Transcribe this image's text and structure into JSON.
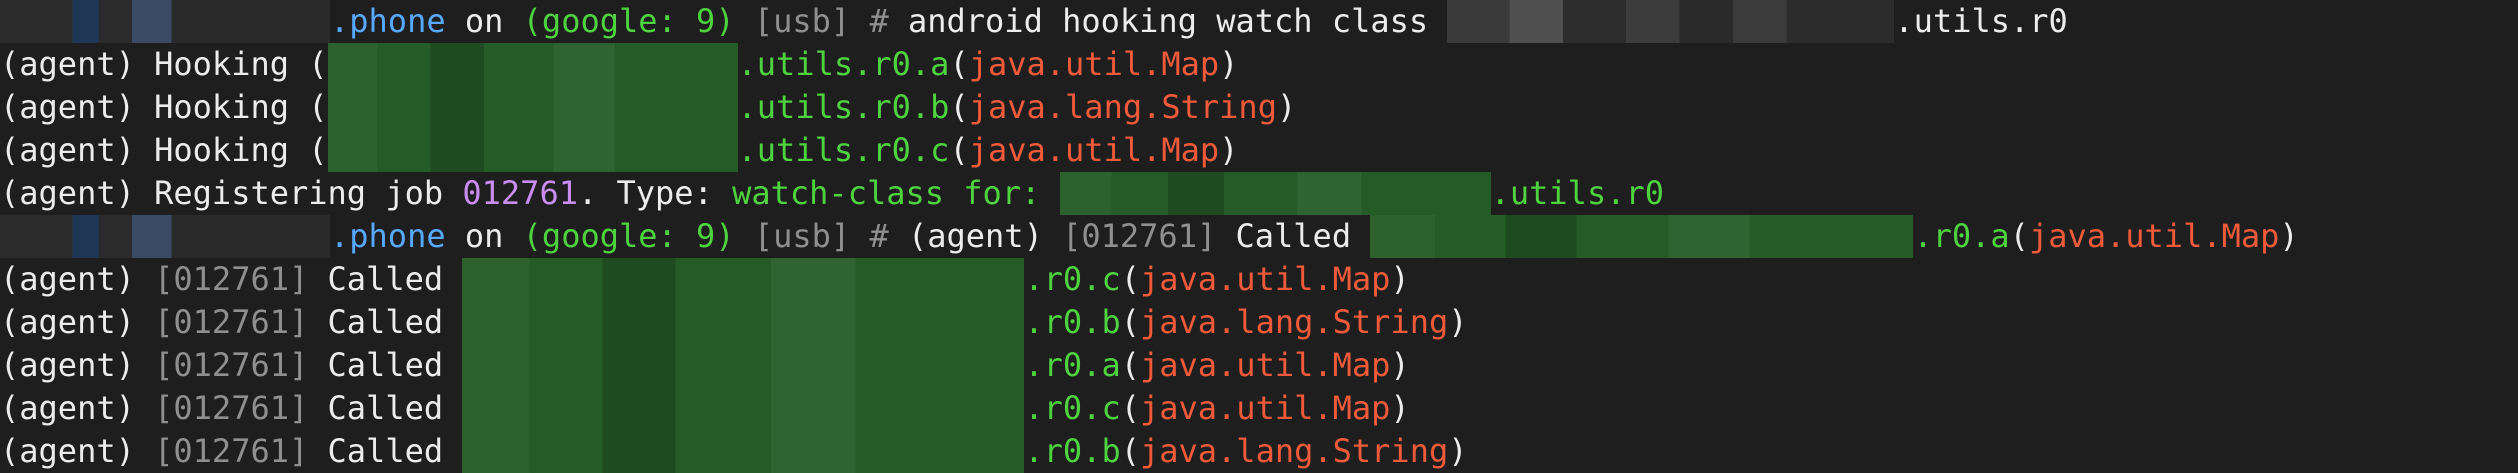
{
  "prompt": {
    "host_suffix": ".phone",
    "on_word": " on ",
    "device": "(google: 9)",
    "transport": " [usb]",
    "hash": " # "
  },
  "lines": [
    {
      "kind": "command",
      "command": "android hooking watch class ",
      "class_suffix": ".utils.r0"
    },
    {
      "kind": "hook",
      "prefix": "(agent) Hooking ",
      "pre_blur": "(",
      "method": ".utils.r0.a",
      "lparen": "(",
      "arg": "java.util.Map",
      "rparen": ")"
    },
    {
      "kind": "hook",
      "prefix": "(agent) Hooking ",
      "pre_blur": "(",
      "method": ".utils.r0.b",
      "lparen": "(",
      "arg": "java.lang.String",
      "rparen": ")"
    },
    {
      "kind": "hook",
      "prefix": "(agent) Hooking ",
      "pre_blur": "(",
      "method": ".utils.r0.c",
      "lparen": "(",
      "arg": "java.util.Map",
      "rparen": ")"
    },
    {
      "kind": "register",
      "prefix": "(agent) Registering job ",
      "job": "012761",
      "mid": ". Type: ",
      "type": "watch-class for: ",
      "class_suffix": ".utils.r0"
    },
    {
      "kind": "prompt-called",
      "agent": "(agent) ",
      "job": "[012761]",
      "called": " Called ",
      "method": ".r0.a",
      "lparen": "(",
      "arg": "java.util.Map",
      "rparen": ")"
    },
    {
      "kind": "called",
      "agent": "(agent) ",
      "job": "[012761]",
      "called": " Called ",
      "method": ".r0.c",
      "lparen": "(",
      "arg": "java.util.Map",
      "rparen": ")"
    },
    {
      "kind": "called",
      "agent": "(agent) ",
      "job": "[012761]",
      "called": " Called ",
      "method": ".r0.b",
      "lparen": "(",
      "arg": "java.lang.String",
      "rparen": ")"
    },
    {
      "kind": "called",
      "agent": "(agent) ",
      "job": "[012761]",
      "called": " Called ",
      "method": ".r0.a",
      "lparen": "(",
      "arg": "java.util.Map",
      "rparen": ")"
    },
    {
      "kind": "called",
      "agent": "(agent) ",
      "job": "[012761]",
      "called": " Called ",
      "method": ".r0.c",
      "lparen": "(",
      "arg": "java.util.Map",
      "rparen": ")"
    },
    {
      "kind": "called",
      "agent": "(agent) ",
      "job": "[012761]",
      "called": " Called ",
      "method": ".r0.b",
      "lparen": "(",
      "arg": "java.lang.String",
      "rparen": ")"
    }
  ],
  "colors": {
    "background": "#1e1e1e",
    "text": "#ececec",
    "host": "#57a8ff",
    "green": "#4ed23f",
    "gray": "#8f8f8f",
    "type": "#ef5a3a",
    "job_id": "#c98cf0"
  }
}
